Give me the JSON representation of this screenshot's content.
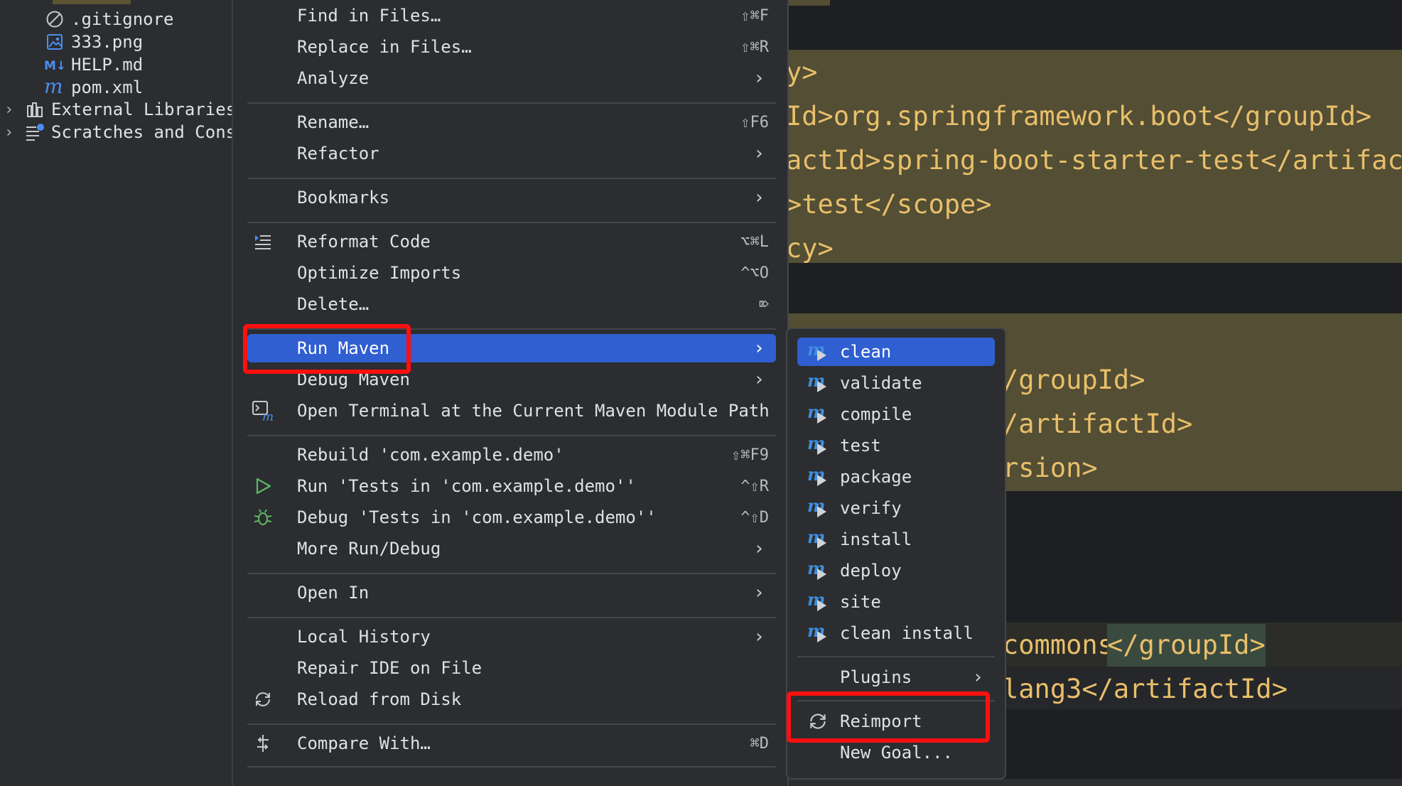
{
  "project_tree": {
    "items": [
      {
        "label": ".gitignore",
        "icon": "ignore-icon"
      },
      {
        "label": "333.png",
        "icon": "image-icon"
      },
      {
        "label": "HELP.md",
        "icon": "markdown-icon"
      },
      {
        "label": "pom.xml",
        "icon": "maven-icon"
      },
      {
        "label": "External Libraries",
        "icon": "library-icon"
      },
      {
        "label": "Scratches and Consoles",
        "icon": "scratches-icon"
      }
    ]
  },
  "editor": {
    "lines": [
      "y>",
      "Id>org.springframework.boot</groupId>",
      "actId>spring-boot-starter-test</artifactId>",
      ">test</scope>",
      "cy>",
      "/groupId>",
      "/artifactId>",
      "rsion>",
      "commons",
      "</groupId>",
      "lang3</artifactId>"
    ]
  },
  "context_menu": {
    "items": [
      {
        "label": "Find in Files…",
        "shortcut": "⇧⌘F"
      },
      {
        "label": "Replace in Files…",
        "shortcut": "⇧⌘R"
      },
      {
        "label": "Analyze"
      },
      {
        "label": "Rename…",
        "shortcut": "⇧F6"
      },
      {
        "label": "Refactor"
      },
      {
        "label": "Bookmarks"
      },
      {
        "label": "Reformat Code",
        "shortcut": "⌥⌘L"
      },
      {
        "label": "Optimize Imports",
        "shortcut": "^⌥O"
      },
      {
        "label": "Delete…",
        "shortcut": "⌦"
      },
      {
        "label": "Run Maven"
      },
      {
        "label": "Debug Maven"
      },
      {
        "label": "Open Terminal at the Current Maven Module Path"
      },
      {
        "label": "Rebuild 'com.example.demo'",
        "shortcut": "⇧⌘F9"
      },
      {
        "label": "Run 'Tests in 'com.example.demo''",
        "shortcut": "^⇧R"
      },
      {
        "label": "Debug 'Tests in 'com.example.demo''",
        "shortcut": "^⇧D"
      },
      {
        "label": "More Run/Debug"
      },
      {
        "label": "Open In"
      },
      {
        "label": "Local History"
      },
      {
        "label": "Repair IDE on File"
      },
      {
        "label": "Reload from Disk"
      },
      {
        "label": "Compare With…",
        "shortcut": "⌘D"
      }
    ],
    "arrow_glyph": "›"
  },
  "maven_submenu": {
    "goals": [
      "clean",
      "validate",
      "compile",
      "test",
      "package",
      "verify",
      "install",
      "deploy",
      "site",
      "clean install"
    ],
    "plugins_label": "Plugins",
    "reimport_label": "Reimport",
    "new_goal_label": "New Goal..."
  },
  "colors": {
    "selection": "#2f5fd0",
    "highlight_box": "#ff1010",
    "maven_icon": "#3d8fe0",
    "run_icon": "#5fb865"
  }
}
